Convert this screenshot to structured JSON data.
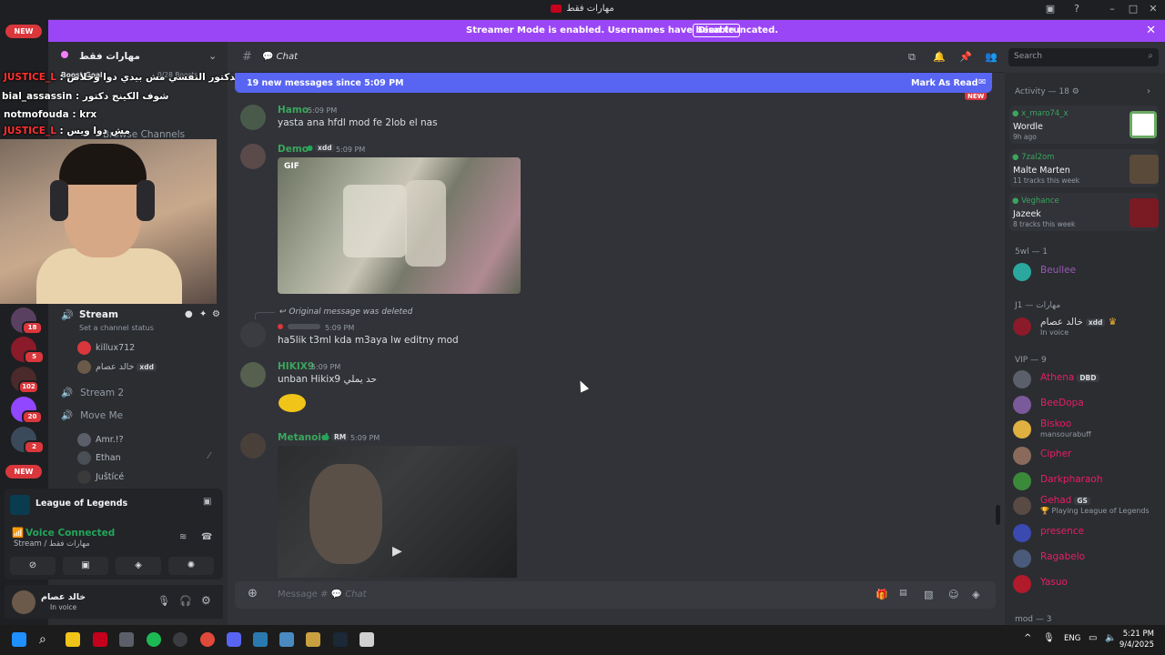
{
  "titlebar": {
    "title": "مهارات فقط"
  },
  "banner": {
    "text": "Streamer Mode is enabled. Usernames have been truncated.",
    "button": "Disable"
  },
  "rail": {
    "new_top": "NEW",
    "new_bottom": "NEW",
    "badges": [
      "18",
      "5",
      "102",
      "20",
      "2"
    ]
  },
  "sidebar": {
    "server_name": "مهارات فقط",
    "boost_goal": "Boost Goal",
    "boosts": "0/28 Boosts",
    "browse": "Browse Channels",
    "stream_channel": "Stream",
    "status_hint": "Set a channel status",
    "users": [
      {
        "name": "killux712"
      },
      {
        "name": "خالد عصام",
        "tag": "xdd"
      }
    ],
    "stream2": "Stream 2",
    "moveme": "Move Me",
    "users2": [
      {
        "name": "Amr.!?"
      },
      {
        "name": "Ethan"
      },
      {
        "name": "Juštícé"
      }
    ]
  },
  "overlay_chat": [
    {
      "user": "JUSTICE_L",
      "text": ": بيقول الدكتور النفسي مش بيدي دوا وخلاص"
    },
    {
      "user": "bial_assassin",
      "text": ": شوف الكينج دكتور"
    },
    {
      "user": "notmofouda",
      "text": ": krx"
    },
    {
      "user": "JUSTICE_L",
      "text": ": مش دوا ويس"
    }
  ],
  "voice": {
    "activity": "League of Legends",
    "status": "Voice Connected",
    "channel": "Stream / مهارات فقط"
  },
  "userbar": {
    "name": "خالد عصام",
    "status": "In voice"
  },
  "chat": {
    "channel": "Chat",
    "new_messages": "19 new messages since 5:09 PM",
    "mark_read": "Mark As Read",
    "new_tag": "NEW",
    "messages": [
      {
        "author": "Hamo",
        "time": "5:09 PM",
        "text": "yasta ana hfdl mod fe 2lob el nas",
        "color": "#3ba55d"
      },
      {
        "author": "Demo",
        "tag": "xdd",
        "time": "5:09 PM",
        "gif_label": "GIF",
        "color": "#3ba55d"
      },
      {
        "reply": "Original message was deleted",
        "time": "5:09 PM",
        "text": "ha5lik t3ml kda m3aya lw editny mod"
      },
      {
        "author": "HIKIX9",
        "time": "5:09 PM",
        "text": "unban Hikix9 حد يملي",
        "color": "#3ba55d"
      },
      {
        "author": "Metanoid",
        "tag": "RM",
        "time": "5:09 PM",
        "color": "#3ba55d"
      }
    ],
    "composer_placeholder": "Message #",
    "composer_channel": "Chat"
  },
  "search": {
    "placeholder": "Search"
  },
  "members": {
    "activity_header": "Activity — 18",
    "activities": [
      {
        "user": "x_maro74_x",
        "title": "Wordle",
        "sub": "9h ago"
      },
      {
        "user": "7zal2om",
        "title": "Malte Marten",
        "sub": "11 tracks this week"
      },
      {
        "user": "Veghance",
        "title": "Jazeek",
        "sub": "8 tracks this week"
      }
    ],
    "groups": [
      {
        "header": "5wl — 1",
        "members": [
          {
            "name": "Beullee",
            "color": "#9b59b6"
          }
        ]
      },
      {
        "header": "J1 — مهارات",
        "members": [
          {
            "name": "خالد عصام",
            "sub": "In voice",
            "tag": "xdd",
            "color": "#dbdee1"
          }
        ]
      },
      {
        "header": "VIP — 9",
        "members": [
          {
            "name": "Athena",
            "tag": "DBD",
            "color": "#e91e63"
          },
          {
            "name": "BeeDopa",
            "color": "#e91e63"
          },
          {
            "name": "Biskoo",
            "sub": "mansourabuff",
            "color": "#e91e63"
          },
          {
            "name": "Cipher",
            "color": "#e91e63"
          },
          {
            "name": "Darkpharaoh",
            "color": "#e91e63"
          },
          {
            "name": "Gehad",
            "tag": "GS",
            "sub": "Playing League of Legends",
            "color": "#e91e63"
          },
          {
            "name": "presence",
            "color": "#e91e63"
          },
          {
            "name": "Ragabelo",
            "color": "#e91e63"
          },
          {
            "name": "Yasuo",
            "color": "#e91e63"
          }
        ]
      },
      {
        "header": "mod — 3",
        "members": []
      }
    ]
  },
  "taskbar": {
    "lang": "ENG",
    "time": "5:21 PM",
    "date": "9/4/2025"
  }
}
